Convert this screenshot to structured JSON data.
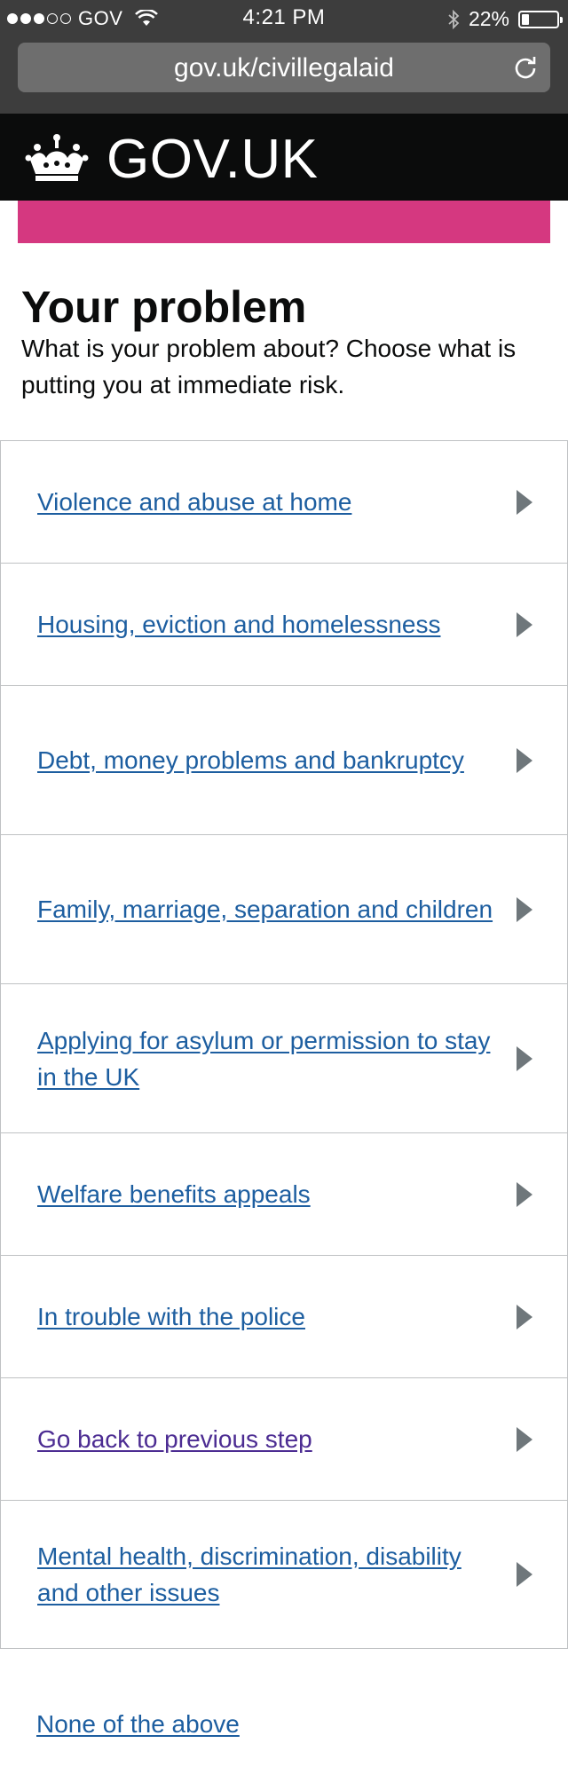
{
  "status_bar": {
    "carrier": "GOV",
    "time": "4:21 PM",
    "battery": "22%",
    "battery_level": 0.22,
    "signal_bars_filled": 3,
    "signal_bars_total": 5
  },
  "browser": {
    "url": "gov.uk/civillegalaid"
  },
  "header": {
    "logo_text": "GOV.UK"
  },
  "colors": {
    "header_bg": "#0b0c0c",
    "accent_bar": "#d53880",
    "link": "#1d5ea0",
    "visited_link": "#4c2c92",
    "arrow": "#6f777b"
  },
  "page": {
    "title": "Your problem",
    "lead": "What is your problem about? Choose what is putting you at immediate risk."
  },
  "options": [
    {
      "label": "Violence and abuse at home"
    },
    {
      "label": "Housing, eviction and homelessness"
    },
    {
      "label": "Debt, money problems and bankruptcy"
    },
    {
      "label": "Family, marriage, separation and children"
    },
    {
      "label": "Applying for asylum or permission to stay in the UK"
    },
    {
      "label": "Welfare benefits appeals"
    },
    {
      "label": "In trouble with the police"
    },
    {
      "label": "Go back to previous step"
    },
    {
      "label": "Mental health, discrimination, disability and other issues"
    }
  ],
  "none_link": "None of the above"
}
